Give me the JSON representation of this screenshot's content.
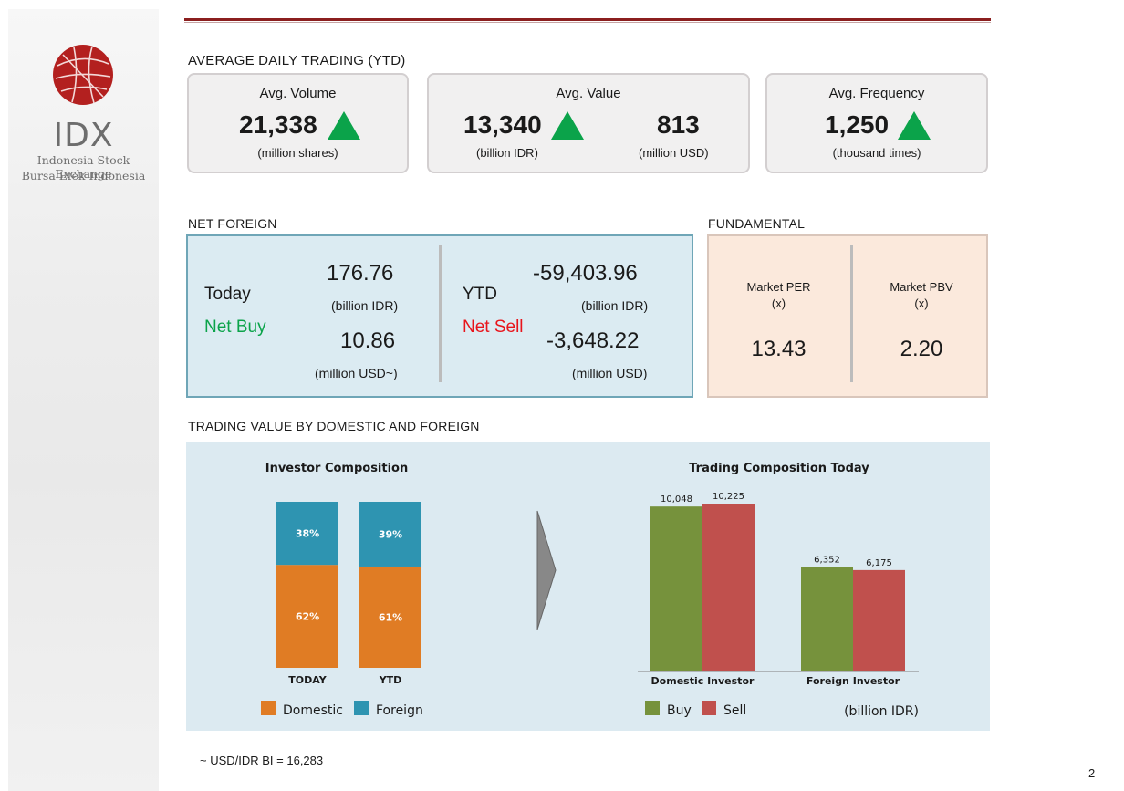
{
  "brand": {
    "logo_text": "IDX",
    "subtitle_1": "Indonesia Stock Exchange",
    "subtitle_2": "Bursa Efek Indonesia"
  },
  "adt": {
    "section_title": "AVERAGE DAILY TRADING (YTD)",
    "volume": {
      "title": "Avg. Volume",
      "value": "21,338",
      "unit": "(million shares)",
      "trend": "up"
    },
    "value": {
      "title": "Avg. Value",
      "value_idr": "13,340",
      "unit_idr": "(billion IDR)",
      "value_usd": "813",
      "unit_usd": "(million USD)",
      "trend": "up"
    },
    "frequency": {
      "title": "Avg. Frequency",
      "value": "1,250",
      "unit": "(thousand times)",
      "trend": "up"
    }
  },
  "net_foreign": {
    "section_title": "NET FOREIGN",
    "today": {
      "label": "Today",
      "status": "Net Buy",
      "idr": "176.76",
      "idr_unit": "(billion IDR)",
      "usd": "10.86",
      "usd_unit": "(million USD~)"
    },
    "ytd": {
      "label": "YTD",
      "status": "Net Sell",
      "idr": "-59,403.96",
      "idr_unit": "(billion IDR)",
      "usd": "-3,648.22",
      "usd_unit": "(million USD)"
    }
  },
  "fundamental": {
    "section_title": "FUNDAMENTAL",
    "per": {
      "label_1": "Market PER",
      "label_2": "(x)",
      "value": "13.43"
    },
    "pbv": {
      "label_1": "Market PBV",
      "label_2": "(x)",
      "value": "2.20"
    }
  },
  "trading_section_title": "TRADING VALUE BY DOMESTIC AND FOREIGN",
  "colors": {
    "up_green": "#0ba34a",
    "net_buy": "#0ba34a",
    "net_sell": "#e8141b",
    "domestic": "#e07c24",
    "foreign": "#2e94b1",
    "buy": "#76923c",
    "sell": "#c0504d"
  },
  "chart_data": [
    {
      "type": "bar",
      "stacked": true,
      "percent": true,
      "title": "Investor Composition",
      "categories": [
        "TODAY",
        "YTD"
      ],
      "series": [
        {
          "name": "Domestic",
          "values": [
            62,
            61
          ],
          "labels": [
            "62%",
            "61%"
          ]
        },
        {
          "name": "Foreign",
          "values": [
            38,
            39
          ],
          "labels": [
            "38%",
            "39%"
          ]
        }
      ],
      "legend": "bottom"
    },
    {
      "type": "bar",
      "title": "Trading Composition Today",
      "categories": [
        "Domestic Investor",
        "Foreign Investor"
      ],
      "series": [
        {
          "name": "Buy",
          "values": [
            10048,
            6352
          ],
          "labels": [
            "10,048",
            "6,352"
          ]
        },
        {
          "name": "Sell",
          "values": [
            10225,
            6175
          ],
          "labels": [
            "10,225",
            "6,175"
          ]
        }
      ],
      "unit_note": "(billion IDR)",
      "legend": "bottom",
      "grid": false
    }
  ],
  "footnote": "~ USD/IDR BI = 16,283",
  "page_number": "2"
}
